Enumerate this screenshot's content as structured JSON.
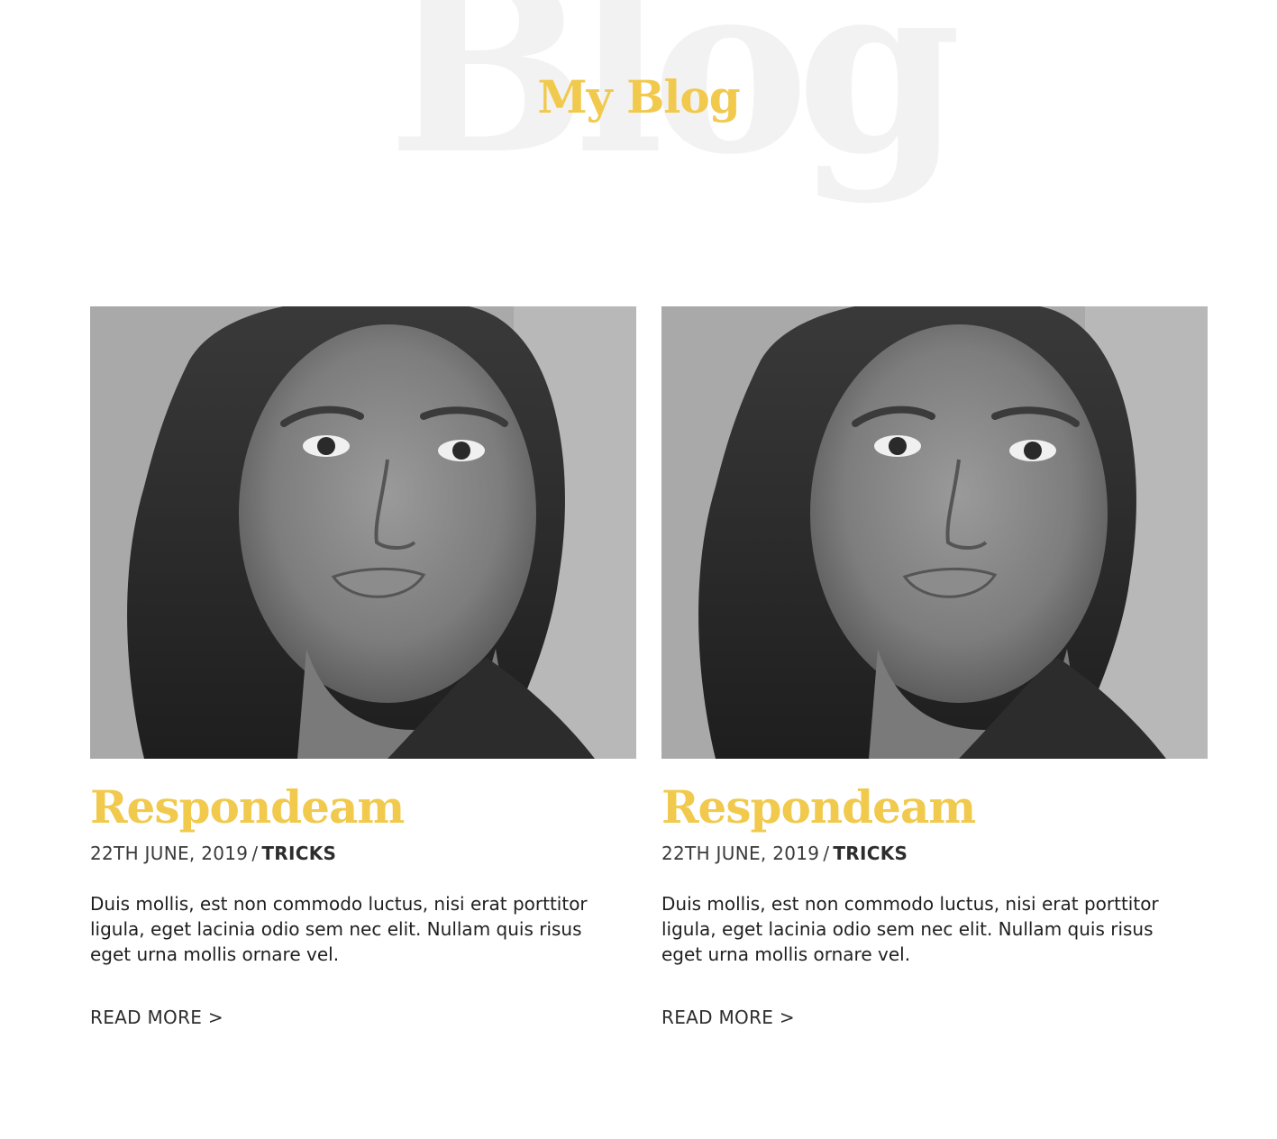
{
  "section": {
    "background_word": "Blog",
    "title": "My Blog"
  },
  "colors": {
    "accent": "#f1c94d",
    "watermark": "#f2f2f2",
    "text": "#2d2d2d"
  },
  "posts": [
    {
      "image_alt": "grayscale portrait photo",
      "title": "Respondeam",
      "date": "22TH JUNE, 2019",
      "separator": "/",
      "category": "TRICKS",
      "excerpt": "Duis mollis, est non commodo luctus, nisi erat porttitor ligula, eget lacinia odio sem nec elit. Nullam quis risus eget urna mollis ornare vel.",
      "read_more": "READ MORE >"
    },
    {
      "image_alt": "grayscale portrait photo",
      "title": "Respondeam",
      "date": "22TH JUNE, 2019",
      "separator": "/",
      "category": "TRICKS",
      "excerpt": "Duis mollis, est non commodo luctus, nisi erat porttitor ligula, eget lacinia odio sem nec elit. Nullam quis risus eget urna mollis ornare vel.",
      "read_more": "READ MORE >"
    }
  ]
}
